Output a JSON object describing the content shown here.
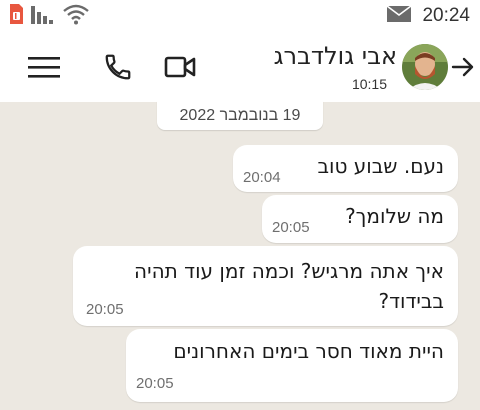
{
  "status_bar": {
    "time": "20:24",
    "icons": [
      "sim-card-icon",
      "signal-icon",
      "wifi-icon",
      "mail-icon"
    ]
  },
  "header": {
    "contact_name": "אבי גולדברג",
    "last_seen": "10:15",
    "icons": [
      "menu-icon",
      "call-icon",
      "video-call-icon",
      "back-arrow-icon"
    ],
    "avatar": "avatar"
  },
  "date_separator": "19 בנובמבר 2022",
  "messages": [
    {
      "text": "נעם. שבוע טוב",
      "time": "20:04"
    },
    {
      "text": "מה שלומך?",
      "time": "20:05"
    },
    {
      "text_lines": [
        "איך אתה מרגיש? וכמה זמן עוד תהיה",
        "בבידוד?"
      ],
      "time": "20:05"
    },
    {
      "text": "היית מאוד חסר בימים האחרונים",
      "time": "20:05"
    }
  ],
  "colors": {
    "chat_background": "#ece8e1",
    "bubble": "#ffffff",
    "header": "#ffffff",
    "time_text": "#6f6f6f"
  }
}
